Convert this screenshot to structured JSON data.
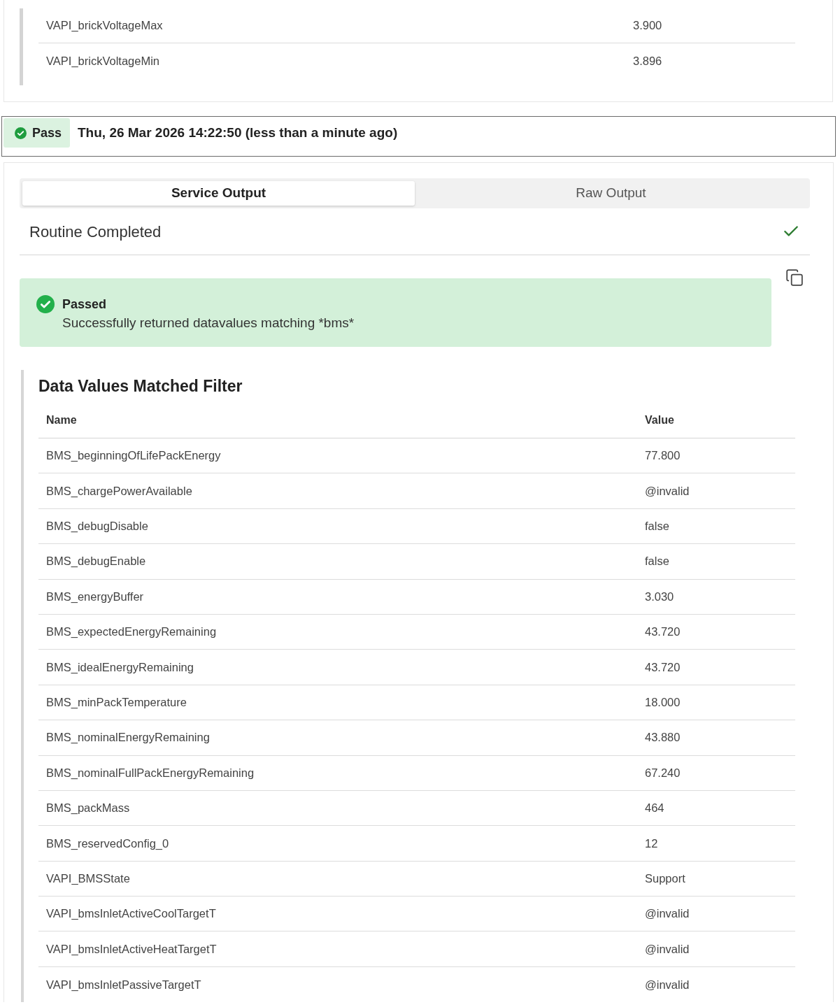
{
  "previous_result": {
    "rows": [
      {
        "name": "VAPI_brickVoltageMax",
        "value": "3.900"
      },
      {
        "name": "VAPI_brickVoltageMin",
        "value": "3.896"
      }
    ]
  },
  "result_header": {
    "status": {
      "kind": "pass",
      "label": "Pass"
    },
    "timestamp": "Thu, 26 Mar 2026 14:22:50 (less than a minute ago)"
  },
  "tabs": [
    {
      "label": "Service Output",
      "selected": true
    },
    {
      "label": "Raw Output",
      "selected": false
    }
  ],
  "routine": {
    "title": "Routine Completed",
    "completed": true
  },
  "alert": {
    "kind": "success",
    "title": "Passed",
    "message": "Successfully returned datavalues matching *bms*"
  },
  "data_table": {
    "title": "Data Values Matched Filter",
    "columns": [
      "Name",
      "Value"
    ],
    "rows": [
      {
        "name": "BMS_beginningOfLifePackEnergy",
        "value": "77.800"
      },
      {
        "name": "BMS_chargePowerAvailable",
        "value": "@invalid"
      },
      {
        "name": "BMS_debugDisable",
        "value": "false"
      },
      {
        "name": "BMS_debugEnable",
        "value": "false"
      },
      {
        "name": "BMS_energyBuffer",
        "value": "3.030"
      },
      {
        "name": "BMS_expectedEnergyRemaining",
        "value": "43.720"
      },
      {
        "name": "BMS_idealEnergyRemaining",
        "value": "43.720"
      },
      {
        "name": "BMS_minPackTemperature",
        "value": "18.000"
      },
      {
        "name": "BMS_nominalEnergyRemaining",
        "value": "43.880"
      },
      {
        "name": "BMS_nominalFullPackEnergyRemaining",
        "value": "67.240"
      },
      {
        "name": "BMS_packMass",
        "value": "464"
      },
      {
        "name": "BMS_reservedConfig_0",
        "value": "12"
      },
      {
        "name": "VAPI_BMSState",
        "value": "Support"
      },
      {
        "name": "VAPI_bmsInletActiveCoolTargetT",
        "value": "@invalid"
      },
      {
        "name": "VAPI_bmsInletActiveHeatTargetT",
        "value": "@invalid"
      },
      {
        "name": "VAPI_bmsInletPassiveTargetT",
        "value": "@invalid"
      }
    ]
  }
}
